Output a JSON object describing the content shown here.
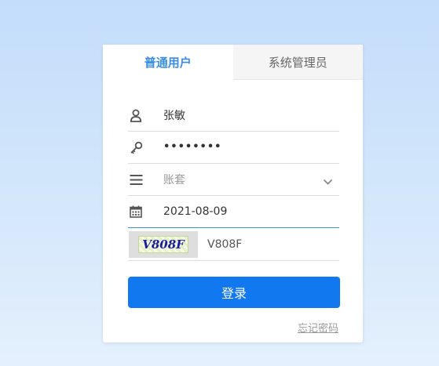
{
  "tabs": {
    "normal_user": "普通用户",
    "admin": "系统管理员"
  },
  "form": {
    "username_value": "张敏",
    "password_mask": "••••••••",
    "account_set_placeholder": "账套",
    "date_value": "2021-08-09",
    "captcha_image_text": "V808F",
    "captcha_input_value": "V808F"
  },
  "actions": {
    "login_label": "登录",
    "forgot_password_label": "忘记密码"
  },
  "colors": {
    "accent": "#3a8ee6",
    "button": "#1178f0",
    "focus_line": "#3c8ee8"
  },
  "icons": [
    "user-icon",
    "key-icon",
    "menu-icon",
    "chevron-down-icon",
    "calendar-icon"
  ]
}
